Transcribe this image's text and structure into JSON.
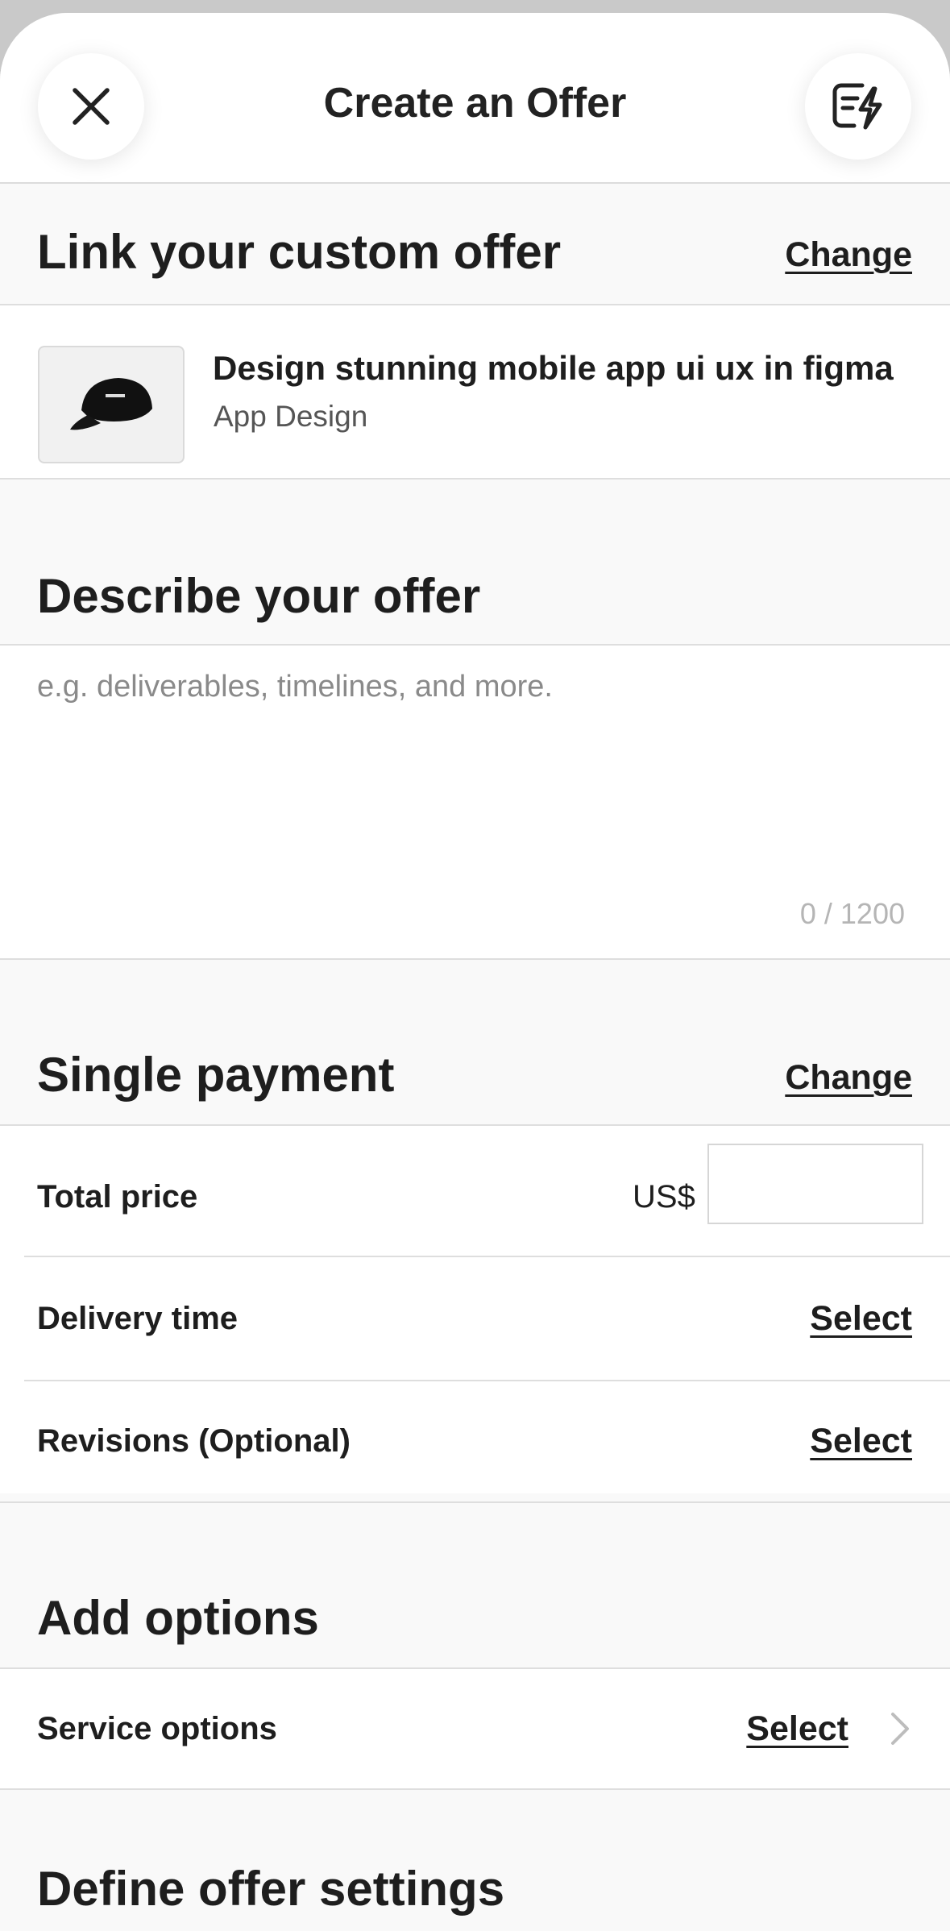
{
  "header": {
    "title": "Create an Offer"
  },
  "link_section": {
    "title": "Link your custom offer",
    "change_label": "Change",
    "gig": {
      "title": "Design stunning mobile app ui ux in figma",
      "category": "App Design"
    }
  },
  "describe_section": {
    "title": "Describe your offer",
    "placeholder": "e.g. deliverables, timelines, and more.",
    "char_count": "0 / 1200"
  },
  "payment_section": {
    "title": "Single payment",
    "change_label": "Change",
    "total_price_label": "Total price",
    "currency": "US$",
    "price_value": "",
    "delivery_label": "Delivery time",
    "delivery_value": "Select",
    "revisions_label": "Revisions (Optional)",
    "revisions_value": "Select"
  },
  "options_section": {
    "title": "Add options",
    "service_label": "Service options",
    "service_value": "Select"
  },
  "settings_section": {
    "title": "Define offer settings"
  }
}
